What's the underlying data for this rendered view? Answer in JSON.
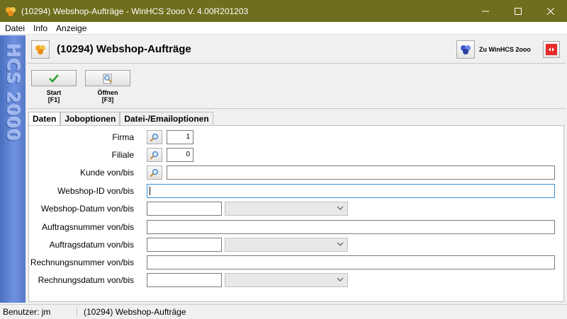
{
  "window": {
    "title": "(10294) Webshop-Aufträge - WinHCS 2ooo V. 4.00R201203"
  },
  "menu": {
    "items": [
      "Datei",
      "Info",
      "Anzeige"
    ]
  },
  "sidebar": {
    "brand": "HCS 2000"
  },
  "header": {
    "title": "(10294) Webshop-Aufträge",
    "link_label": "Zu WinHCS 2ooo"
  },
  "toolbar": {
    "start": {
      "label": "Start",
      "shortcut": "[F1]"
    },
    "open": {
      "label": "Öffnen",
      "shortcut": "[F3]"
    }
  },
  "tabs": [
    "Daten",
    "Joboptionen",
    "Datei-/Emailoptionen"
  ],
  "form": {
    "firma": {
      "label": "Firma",
      "value": "1"
    },
    "filiale": {
      "label": "Filiale",
      "value": "0"
    },
    "kunde": {
      "label": "Kunde von/bis",
      "value": ""
    },
    "webshop_id": {
      "label": "Webshop-ID von/bis",
      "value": ""
    },
    "webshop_datum": {
      "label": "Webshop-Datum von/bis",
      "value": "",
      "select": ""
    },
    "auftragsnummer": {
      "label": "Auftragsnummer von/bis",
      "value": ""
    },
    "auftragsdatum": {
      "label": "Auftragsdatum von/bis",
      "value": "",
      "select": ""
    },
    "rechnungsnummer": {
      "label": "Rechnungsnummer von/bis",
      "value": ""
    },
    "rechnungsdatum": {
      "label": "Rechnungsdatum von/bis",
      "value": "",
      "select": ""
    }
  },
  "status": {
    "user": "Benutzer: jm",
    "module": "(10294) Webshop-Aufträge"
  },
  "colors": {
    "titlebar": "#6e6e1e",
    "sidebar": "#5a7ccc",
    "focus": "#3c8fd0"
  }
}
